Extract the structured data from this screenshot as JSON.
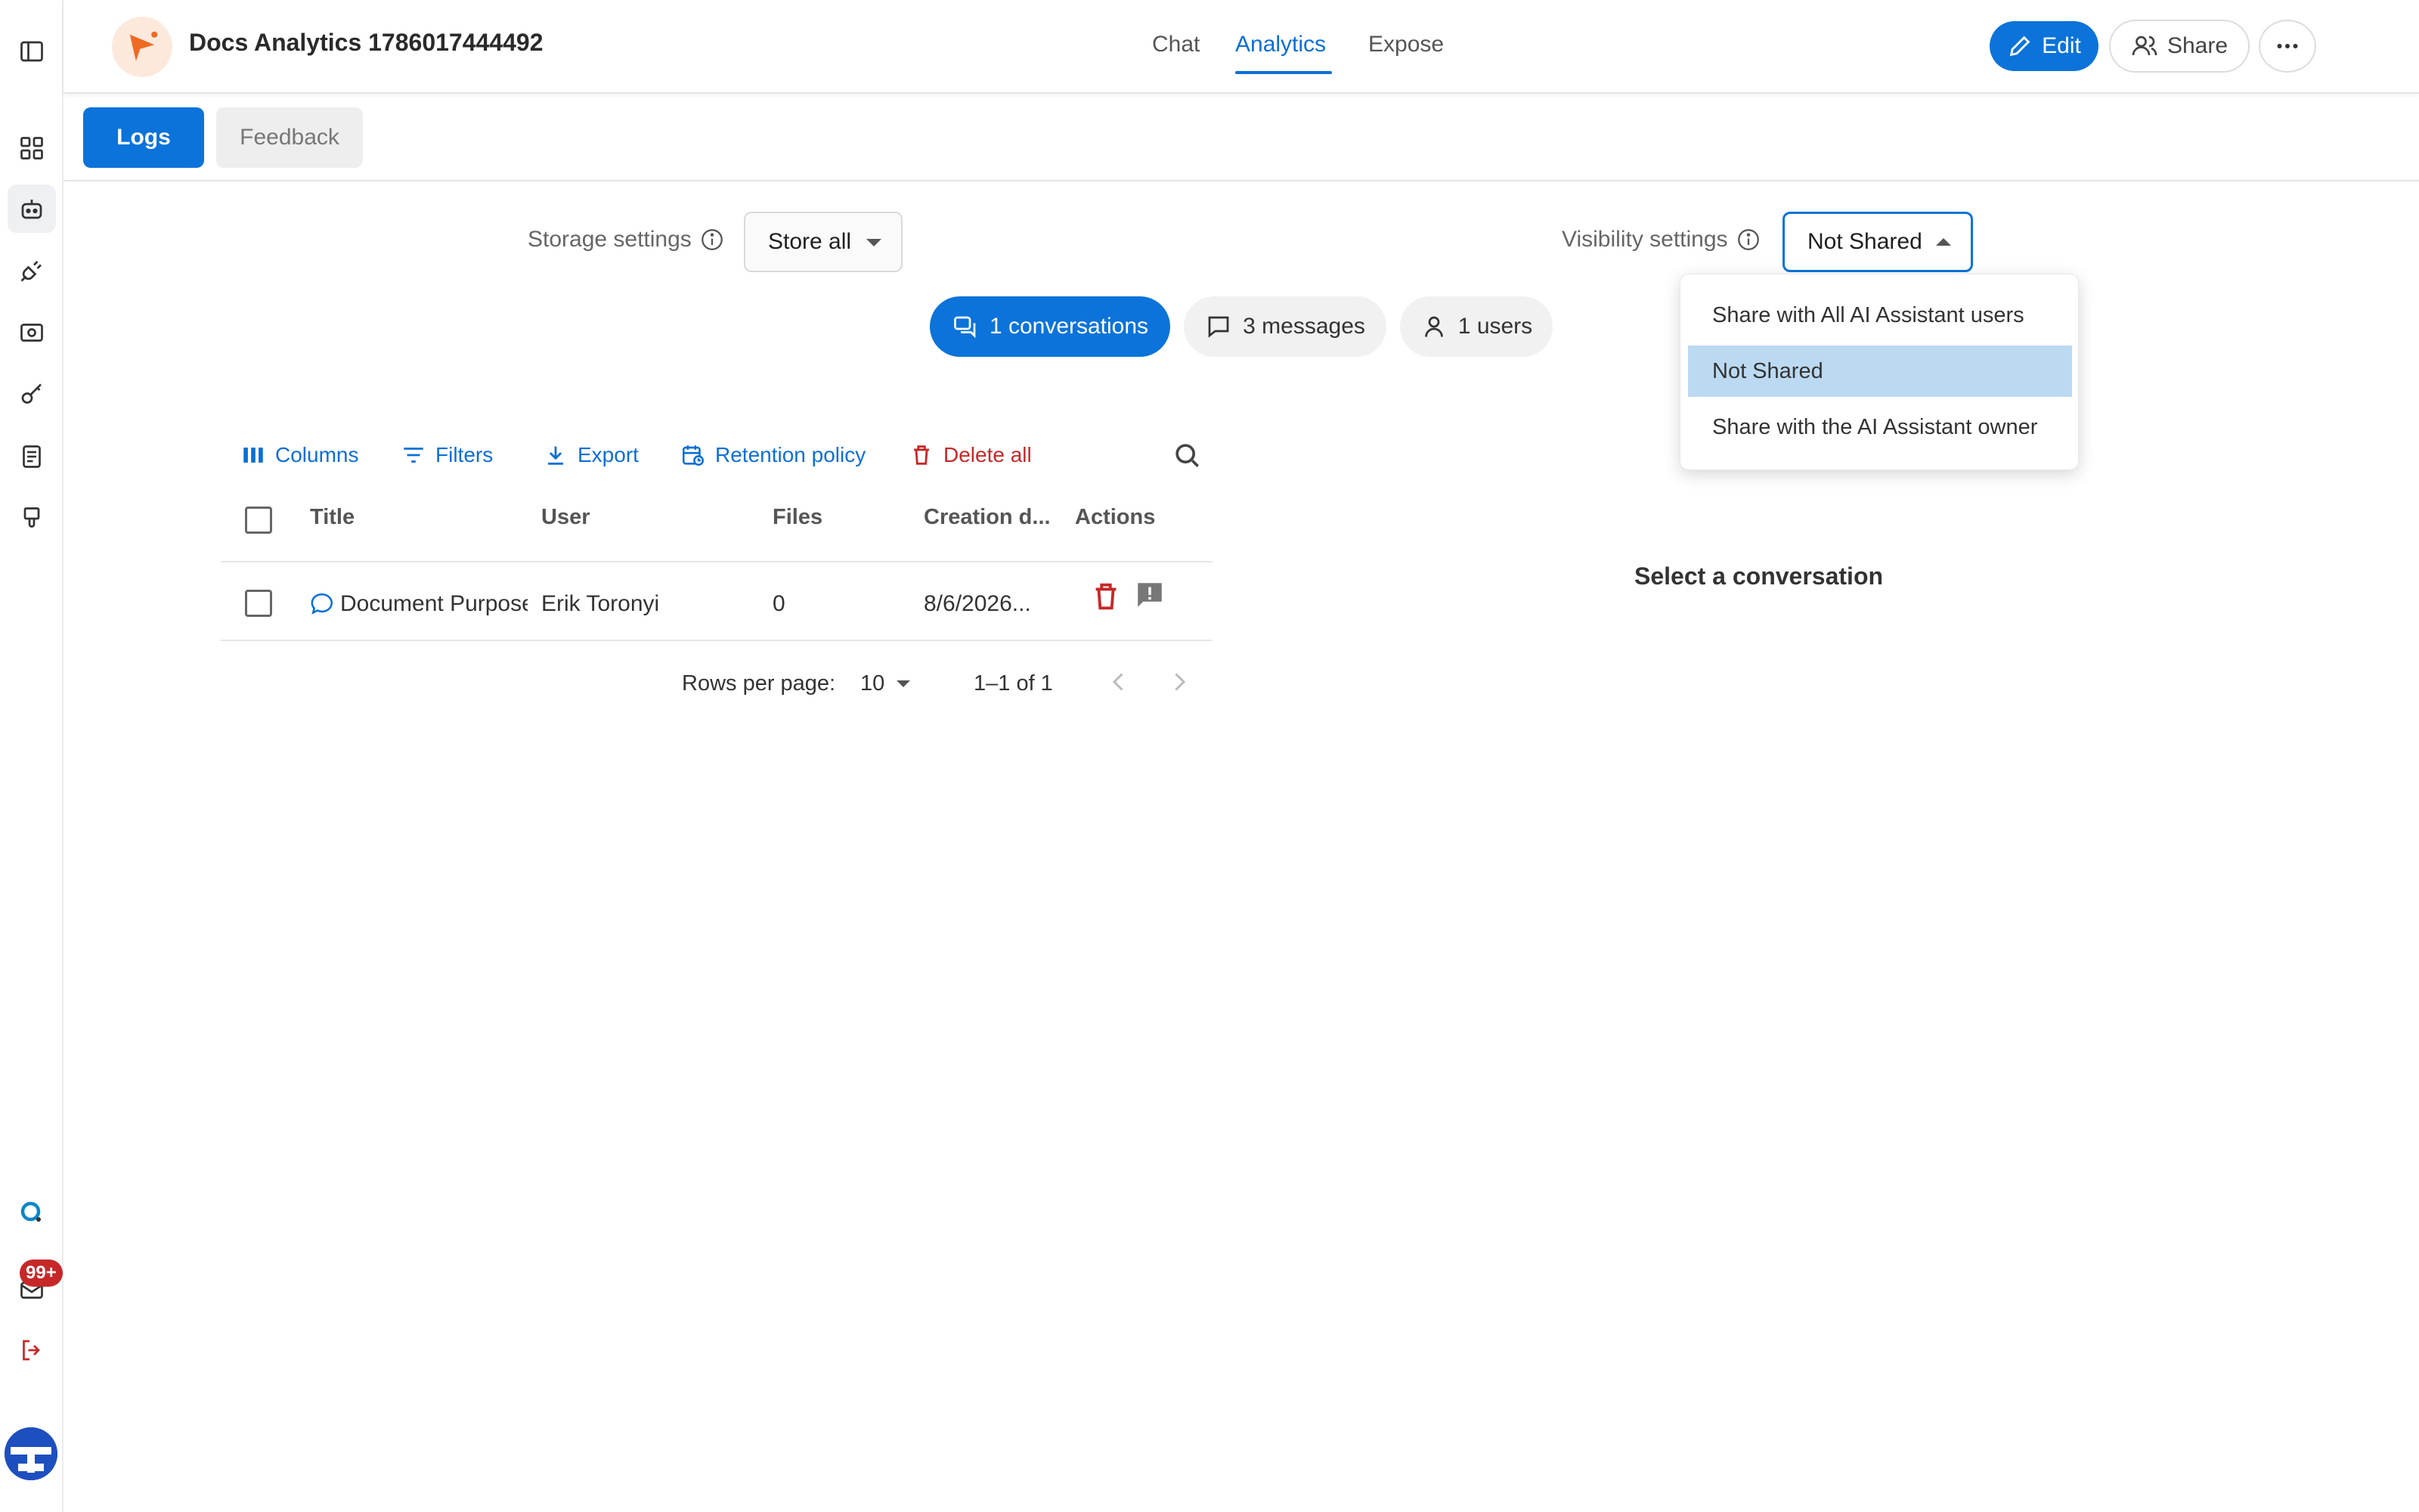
{
  "header": {
    "app_title": "Docs Analytics 1786017444492",
    "tabs": [
      "Chat",
      "Analytics",
      "Expose"
    ],
    "active_tab": "Analytics",
    "edit_label": "Edit",
    "share_label": "Share"
  },
  "subtabs": {
    "logs": "Logs",
    "feedback": "Feedback"
  },
  "storage": {
    "label": "Storage settings",
    "value": "Store all"
  },
  "visibility": {
    "label": "Visibility settings",
    "value": "Not Shared",
    "options": [
      "Share with All AI Assistant users",
      "Not Shared",
      "Share with the AI Assistant owner"
    ],
    "selected_index": 1
  },
  "stats": {
    "conversations": "1 conversations",
    "messages": "3 messages",
    "users": "1 users"
  },
  "toolbar": {
    "columns": "Columns",
    "filters": "Filters",
    "export": "Export",
    "retention": "Retention policy",
    "delete_all": "Delete all"
  },
  "table": {
    "headers": [
      "Title",
      "User",
      "Files",
      "Creation d...",
      "Actions"
    ],
    "rows": [
      {
        "title": "Document Purpose",
        "user": "Erik Toronyi",
        "files": "0",
        "created": "8/6/2026..."
      }
    ]
  },
  "pagination": {
    "rows_label": "Rows per page:",
    "rows_value": "10",
    "range": "1–1 of 1"
  },
  "detail": {
    "empty_text": "Select a conversation"
  },
  "sidebar": {
    "notification_badge": "99+"
  },
  "colors": {
    "accent": "#0b73d9",
    "danger": "#c62828",
    "selected_option": "#bcd9f2"
  }
}
